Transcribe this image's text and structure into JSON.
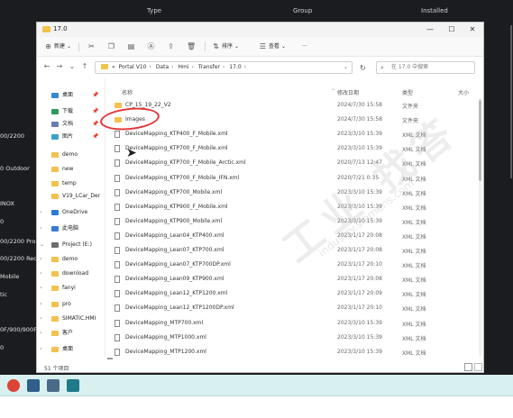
{
  "background_app": {
    "header_columns": [
      "Type",
      "Group",
      "Installed"
    ],
    "left_items": [
      "00/2200",
      "0 Outdoor",
      "INOX",
      "0",
      "00/2200 Pro",
      "00/2200 Redu",
      "Mobile",
      "tic",
      "0F/900/900F",
      "0"
    ]
  },
  "window": {
    "title": "17.0",
    "controls": {
      "minimize": "—",
      "maximize": "☐",
      "close": "✕"
    }
  },
  "toolbar": {
    "new_label": "新建",
    "sort_label": "排序",
    "view_label": "查看",
    "more_label": "···"
  },
  "address": {
    "back": "←",
    "forward": "→",
    "up_history": "⌄",
    "up": "↑",
    "segments": [
      "«",
      "Portal V10",
      "Data",
      "Hmi",
      "Transfer",
      "17.0"
    ],
    "dropdown": "⌄",
    "refresh": "↻",
    "search_placeholder": "在 17.0 中搜索"
  },
  "nav": {
    "items": [
      {
        "label": "桌面",
        "pinned": true,
        "icon": "desktop-icon"
      },
      {
        "label": "下载",
        "pinned": true,
        "icon": "download-icon"
      },
      {
        "label": "文档",
        "pinned": true,
        "icon": "documents-icon"
      },
      {
        "label": "图片",
        "pinned": true,
        "icon": "pictures-icon"
      },
      {
        "label": "demo",
        "icon": "folder-icon"
      },
      {
        "label": "new",
        "icon": "folder-icon"
      },
      {
        "label": "temp",
        "icon": "folder-icon"
      },
      {
        "label": "V19_LCar_Der",
        "icon": "folder-icon"
      },
      {
        "label": "OneDrive",
        "icon": "cloud-icon"
      },
      {
        "label": "此电脑",
        "icon": "pc-icon"
      },
      {
        "label": "Project (E:)",
        "icon": "drive-icon"
      },
      {
        "label": "demo",
        "icon": "folder-icon"
      },
      {
        "label": "download",
        "icon": "folder-icon"
      },
      {
        "label": "fanyi",
        "icon": "folder-icon"
      },
      {
        "label": "pro",
        "icon": "folder-icon"
      },
      {
        "label": "SIMATIC.HMI",
        "icon": "folder-icon"
      },
      {
        "label": "客户",
        "icon": "folder-icon"
      },
      {
        "label": "桌面",
        "icon": "folder-icon"
      }
    ]
  },
  "columns": {
    "name": "名称",
    "date": "修改日期",
    "type": "类型",
    "size": "大小"
  },
  "files": [
    {
      "name": "CP_15_19_22_V2",
      "date": "2024/7/30 15:58",
      "type": "文件夹",
      "kind": "folder"
    },
    {
      "name": "Images",
      "date": "2024/7/30 15:58",
      "type": "文件夹",
      "kind": "folder"
    },
    {
      "name": "DeviceMapping_KTP400_F_Mobile.xml",
      "date": "2023/3/10 15:39",
      "type": "XML 文档",
      "kind": "doc"
    },
    {
      "name": "DeviceMapping_KTP700_F_Mobile.xml",
      "date": "2023/3/10 15:39",
      "type": "XML 文档",
      "kind": "doc"
    },
    {
      "name": "DeviceMapping_KTP700_F_Mobile_Arctic.xml",
      "date": "2020/7/13 12:47",
      "type": "XML 文档",
      "kind": "doc"
    },
    {
      "name": "DeviceMapping_KTP700_F_Mobile_IFN.xml",
      "date": "2020/7/21 0:35",
      "type": "XML 文档",
      "kind": "doc"
    },
    {
      "name": "DeviceMapping_KTP700_Mobile.xml",
      "date": "2023/3/10 15:39",
      "type": "XML 文档",
      "kind": "doc"
    },
    {
      "name": "DeviceMapping_KTP900_F_Mobile.xml",
      "date": "2023/3/10 15:39",
      "type": "XML 文档",
      "kind": "doc"
    },
    {
      "name": "DeviceMapping_KTP900_Mobile.xml",
      "date": "2023/3/10 15:39",
      "type": "XML 文档",
      "kind": "doc"
    },
    {
      "name": "DeviceMapping_Lean04_KTP400.xml",
      "date": "2023/1/17 20:08",
      "type": "XML 文档",
      "kind": "doc"
    },
    {
      "name": "DeviceMapping_Lean07_KTP700.xml",
      "date": "2023/1/17 20:08",
      "type": "XML 文档",
      "kind": "doc"
    },
    {
      "name": "DeviceMapping_Lean07_KTP700DP.xml",
      "date": "2023/1/17 20:10",
      "type": "XML 文档",
      "kind": "doc"
    },
    {
      "name": "DeviceMapping_Lean09_KTP900.xml",
      "date": "2023/1/17 20:08",
      "type": "XML 文档",
      "kind": "doc"
    },
    {
      "name": "DeviceMapping_Lean12_KTP1200.xml",
      "date": "2023/1/17 20:09",
      "type": "XML 文档",
      "kind": "doc"
    },
    {
      "name": "DeviceMapping_Lean12_KTP1200DP.xml",
      "date": "2023/1/17 20:10",
      "type": "XML 文档",
      "kind": "doc"
    },
    {
      "name": "DeviceMapping_MTP700.xml",
      "date": "2023/3/10 15:39",
      "type": "XML 文档",
      "kind": "doc"
    },
    {
      "name": "DeviceMapping_MTP1000.xml",
      "date": "2023/3/10 15:39",
      "type": "XML 文档",
      "kind": "doc"
    },
    {
      "name": "DeviceMapping_MTP1200.xml",
      "date": "2023/3/10 15:39",
      "type": "XML 文档",
      "kind": "doc"
    }
  ],
  "status": {
    "item_count": "51 个项目"
  },
  "watermark": {
    "text": "工业 找答",
    "url": "industry.siemens.com"
  },
  "annotation_color": "#e53535",
  "folder_color": "#f2c14e",
  "taskbar": {
    "items": [
      {
        "icon": "chrome-icon",
        "color": "#db4437"
      },
      {
        "icon": "tia-portal-icon",
        "color": "#2f5f8a"
      },
      {
        "icon": "tool-icon",
        "color": "#4a6a8a"
      },
      {
        "icon": "app-icon",
        "color": "#1d7b8a"
      }
    ]
  }
}
